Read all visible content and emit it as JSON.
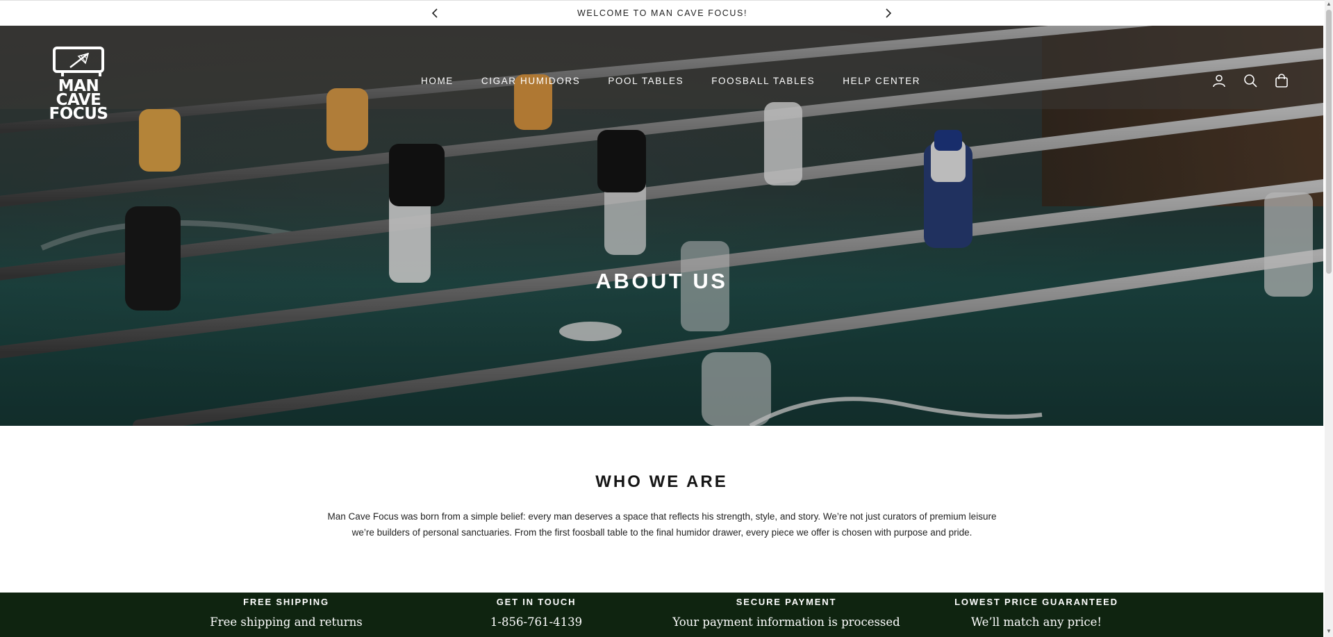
{
  "announcement": {
    "text": "WELCOME TO MAN CAVE FOCUS!"
  },
  "logo": {
    "line1": "MAN CAVE",
    "line2": "FOCUS"
  },
  "nav": {
    "items": [
      {
        "label": "HOME"
      },
      {
        "label": "CIGAR HUMIDORS"
      },
      {
        "label": "POOL TABLES"
      },
      {
        "label": "FOOSBALL TABLES"
      },
      {
        "label": "HELP CENTER"
      }
    ]
  },
  "header_icons": [
    "user-icon",
    "search-icon",
    "bag-icon"
  ],
  "hero": {
    "title": "ABOUT US"
  },
  "who": {
    "title": "WHO WE ARE",
    "body": "Man Cave Focus was born from a simple belief: every man deserves a space that reflects his strength, style, and story. We’re not just curators of premium leisure we’re builders of personal sanctuaries. From the first foosball table to the final humidor drawer, every piece we offer is chosen with purpose and pride."
  },
  "features": [
    {
      "title": "FREE SHIPPING",
      "text": "Free shipping and returns"
    },
    {
      "title": "GET IN TOUCH",
      "text": "1-856-761-4139"
    },
    {
      "title": "SECURE PAYMENT",
      "text": "Your payment information is processed"
    },
    {
      "title": "LOWEST PRICE GUARANTEED",
      "text": "We’ll match any price!"
    }
  ],
  "colors": {
    "feature_bar": "#0f2410",
    "hero_tint": "#1f4d49"
  }
}
